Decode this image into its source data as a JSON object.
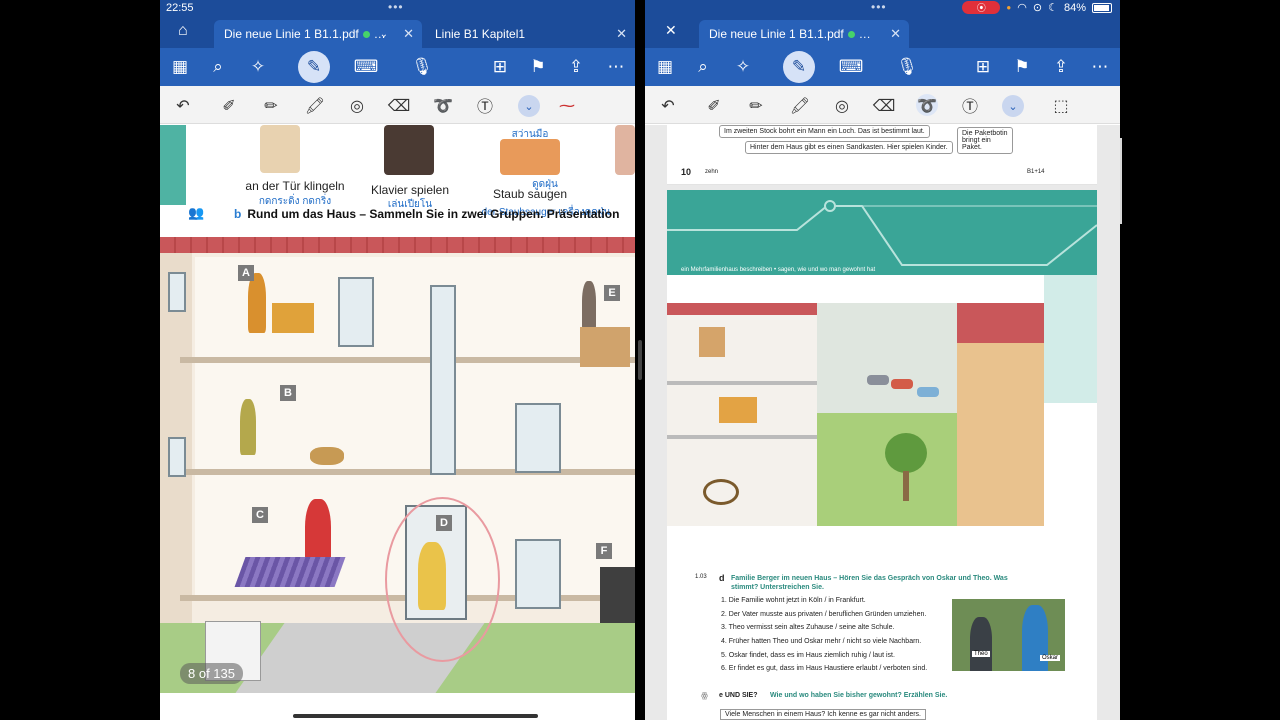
{
  "status": {
    "time": "22:55",
    "battery": "84%"
  },
  "left": {
    "tabs": [
      {
        "label": "Die neue Linie 1 B1.1.pdf"
      },
      {
        "label": "Linie B1 Kapitel1"
      }
    ],
    "captions": [
      {
        "de": "an der Tür klingeln",
        "th": "กดกระดิ่ง กดกริ่ง"
      },
      {
        "de": "Klavier spielen",
        "th": "เล่นเปียโน"
      },
      {
        "de": "Staub saugen",
        "th": "ดูดฝุ่น",
        "th2": "der Staubsauger เครื่องดูดฝุ่น"
      }
    ],
    "top_thai": "สว่านมือ",
    "section_b_letter": "b",
    "section_b_text": "Rund um das Haus – Sammeln Sie in zwei Gruppen. Präsentation",
    "labels": [
      "A",
      "B",
      "C",
      "D",
      "E",
      "F"
    ],
    "page_indicator": "8 of 135"
  },
  "right": {
    "tabs": [
      {
        "label": "Die neue Linie 1 B1.1.pdf"
      }
    ],
    "bubbles": [
      "Im zweiten Stock bohrt ein Mann ein Loch. Das ist bestimmt laut.",
      "Hinter dem Haus gibt es einen Sandkasten. Hier spielen Kinder.",
      "Die Paketbotin bringt ein Paket."
    ],
    "page_number": "10",
    "page_word": "zehn",
    "page_ref": "B1+14",
    "band_text": "ein Mehrfamilienhaus beschreiben  •  sagen, wie und wo man gewohnt hat",
    "exercise_id": "1.03",
    "exercise_letter": "d",
    "exercise_title": "Familie Berger im neuen Haus – Hören Sie das Gespräch von Oskar und Theo. Was stimmt? Unterstreichen Sie.",
    "exercise_items": [
      "1.  Die Familie wohnt jetzt in Köln / in Frankfurt.",
      "2.  Der Vater musste aus privaten / beruflichen Gründen umziehen.",
      "3.  Theo vermisst sein altes Zuhause / seine alte Schule.",
      "4.  Früher hatten Theo und Oskar mehr / nicht so viele Nachbarn.",
      "5.  Oskar findet, dass es im Haus ziemlich ruhig / laut ist.",
      "6.  Er findet es gut, dass im Haus Haustiere erlaubt / verboten sind."
    ],
    "photo_labels": [
      "Theo",
      "Oskar"
    ],
    "und_sie_title": "e  UND SIE?",
    "und_sie_text": "Wie und wo haben Sie bisher gewohnt? Erzählen Sie.",
    "und_sie_bubble": "Viele Menschen in einem Haus? Ich kenne es gar nicht anders."
  }
}
